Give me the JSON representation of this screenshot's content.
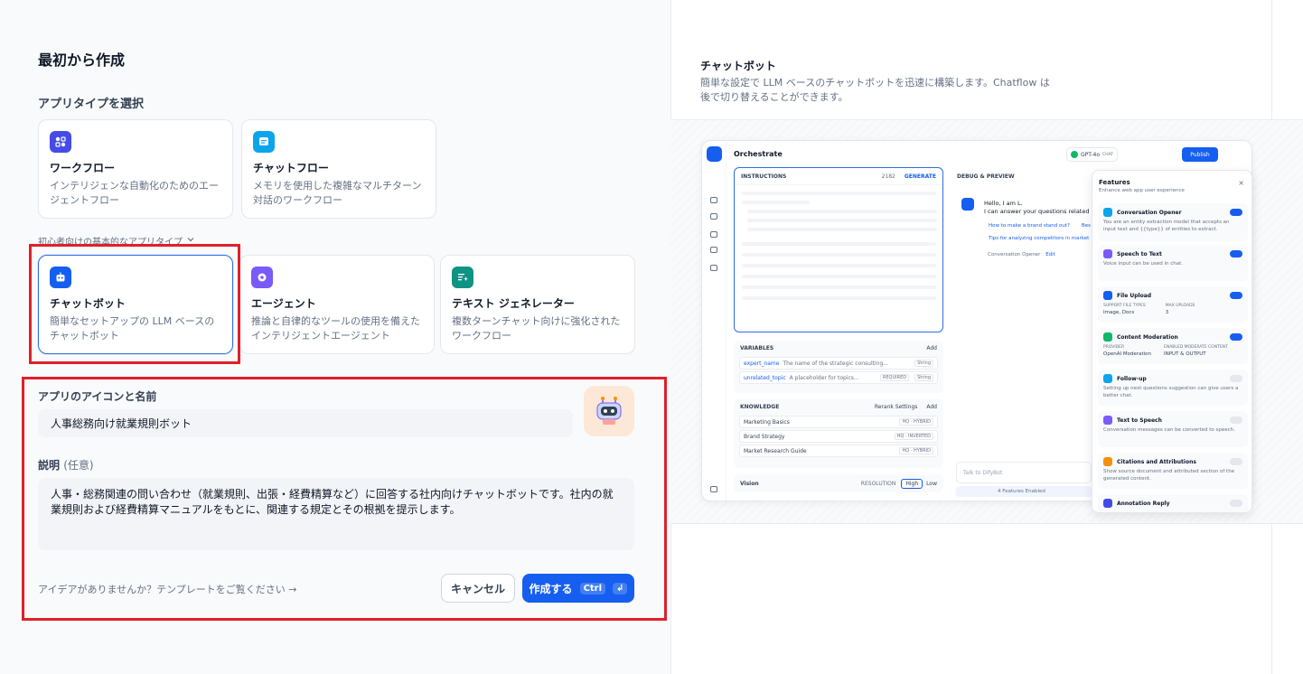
{
  "left": {
    "title": "最初から作成",
    "select_type_label": "アプリタイプを選択",
    "beginner_toggle": "初心者向けの基本的なアプリタイプ",
    "types": [
      {
        "name": "ワークフロー",
        "desc": "インテリジェンな自動化のためのエージェントフロー"
      },
      {
        "name": "チャットフロー",
        "desc": "メモリを使用した複雑なマルチターン対話のワークフロー"
      },
      {
        "name": "チャットボット",
        "desc": "簡単なセットアップの LLM ベースのチャットボット"
      },
      {
        "name": "エージェント",
        "desc": "推論と自律的なツールの使用を備えたインテリジェントエージェント"
      },
      {
        "name": "テキスト ジェネレーター",
        "desc": "複数ターンチャット向けに強化されたワークフロー"
      }
    ],
    "name_label": "アプリのアイコンと名前",
    "name_value": "人事総務向け就業規則ボット",
    "desc_label": "説明",
    "desc_optional": "(任意)",
    "desc_value": "人事・総務関連の問い合わせ（就業規則、出張・経費精算など）に回答する社内向けチャットボットです。社内の就業規則および経費精算マニュアルをもとに、関連する規定とその根拠を提示します。",
    "idea_link": "アイデアがありませんか？テンプレートをご覧ください",
    "cancel": "キャンセル",
    "create": "作成する",
    "create_kbd": "Ctrl"
  },
  "preview": {
    "title": "チャットボット",
    "desc": "簡単な設定で LLM ベースのチャットボットを迅速に構築します。Chatflow は後で切り替えることができます。",
    "mock": {
      "orchestrate": "Orchestrate",
      "model": "GPT-4o",
      "model_tag": "CHAT",
      "publish": "Publish",
      "instructions": "INSTRUCTIONS",
      "instr_count": "2182",
      "generate": "GENERATE",
      "variables": "VARIABLES",
      "add": "Add",
      "var1_name": "expert_name",
      "var1_desc": "The name of the strategic consulting...",
      "var1_type": "String",
      "var2_name": "unrelated_topic",
      "var2_desc": "A placeholder for topics...",
      "var2_req": "REQUIRED",
      "var2_type": "String",
      "knowledge": "KNOWLEDGE",
      "rerank": "Rerank Settings",
      "kb1": "Marketing Basics",
      "kb1_tag": "HQ · HYBRID",
      "kb2": "Brand Strategy",
      "kb2_tag": "HQ · INVERTED",
      "kb3": "Market Research Guide",
      "kb3_tag": "HQ · HYBRID",
      "vision": "Vision",
      "resolution": "RESOLUTION",
      "high": "High",
      "low": "Low",
      "debug": "DEBUG & PREVIEW",
      "chat_line1": "Hello, I am L.",
      "chat_line2": "I can answer your questions related",
      "sug1": "How to make a brand stand out?",
      "sug1b": "Bes",
      "sug2": "Tips for analyzing competitors in market",
      "opener": "Conversation Opener",
      "edit": "Edit",
      "talk": "Talk to DifyBot",
      "features_enabled": "4 Features Enabled",
      "features": "Features",
      "features_sub": "Enhance web app user experience",
      "f1": "Conversation Opener",
      "f1_desc": "You are an entity extraction model that accepts an input text and {{type}} of entities to extract.",
      "f2": "Speech to Text",
      "f2_desc": "Voice input can be used in chat.",
      "f3": "File Upload",
      "f3_k1": "SUPPORT FILE TYPES",
      "f3_v1": "Image, Docs",
      "f3_k2": "MAX UPLOADS",
      "f3_v2": "3",
      "f4": "Content Moderation",
      "f4_k1": "PROVIDER",
      "f4_v1": "OpenAI Moderation",
      "f4_k2": "ENABLED MODERATE CONTENT",
      "f4_v2": "INPUT & OUTPUT",
      "f5": "Follow-up",
      "f5_desc": "Setting up next questions suggestion can give users a better chat.",
      "f6": "Text to Speech",
      "f6_desc": "Conversation messages can be converted to speech.",
      "f7": "Citations and Attributions",
      "f7_desc": "Show source document and attributed section of the generated content.",
      "f8": "Annotation Reply"
    }
  },
  "colors": {
    "accent": "#155eef",
    "highlight": "#e0202a"
  }
}
